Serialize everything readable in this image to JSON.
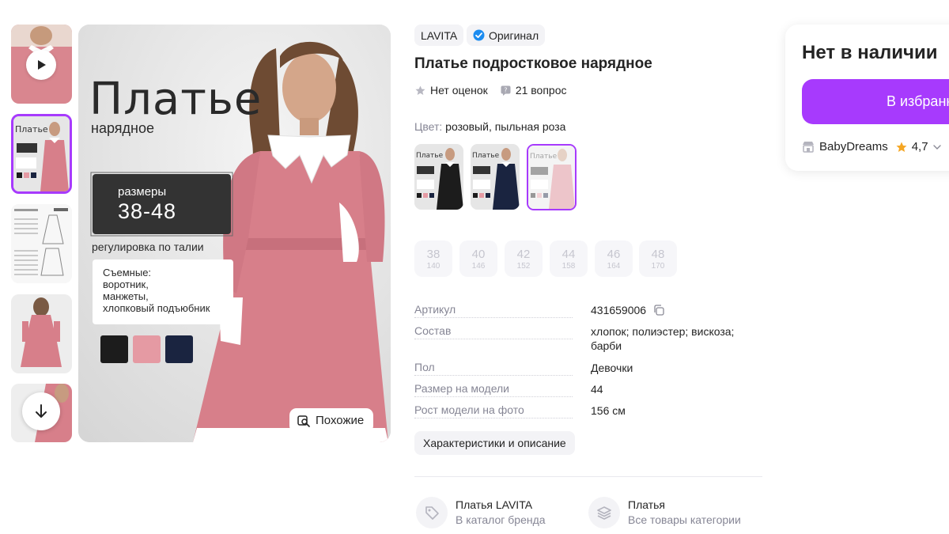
{
  "gallery": {
    "thumb_labels": [
      "video-preview",
      "cover",
      "size-chart",
      "back-view",
      "detail"
    ]
  },
  "photo": {
    "title": "Платье",
    "subtitle": "нарядное",
    "sizes_caption": "размеры",
    "sizes_value": "38-48",
    "waist_text": "регулировка по талии",
    "removable": [
      "Съемные:",
      "воротник,",
      "манжеты,",
      "хлопковый подъюбник"
    ],
    "similar_label": "Похожие",
    "swatch_colors": [
      "#1c1c1c",
      "#e59aa3",
      "#1a2440"
    ]
  },
  "badges": {
    "brand": "LAVITA",
    "original": "Оригинал"
  },
  "product": {
    "title": "Платье подростковое нарядное",
    "rating_text": "Нет оценок",
    "questions_text": "21 вопрос",
    "color_label": "Цвет:",
    "color_value": "розовый, пыльная роза"
  },
  "sizes": [
    {
      "size": "38",
      "height": "140"
    },
    {
      "size": "40",
      "height": "146"
    },
    {
      "size": "42",
      "height": "152"
    },
    {
      "size": "44",
      "height": "158"
    },
    {
      "size": "46",
      "height": "164"
    },
    {
      "size": "48",
      "height": "170"
    }
  ],
  "specs": [
    {
      "key": "Артикул",
      "value": "431659006"
    },
    {
      "key": "Состав",
      "value": "хлопок; полиэстер; вискоза; барби"
    },
    {
      "key": "Пол",
      "value": "Девочки"
    },
    {
      "key": "Размер на модели",
      "value": "44"
    },
    {
      "key": "Рост модели на фото",
      "value": "156 см"
    }
  ],
  "details_button": "Характеристики и описание",
  "links": [
    {
      "title": "Платья LAVITA",
      "subtitle": "В каталог бренда",
      "icon": "tag-icon"
    },
    {
      "title": "Платья",
      "subtitle": "Все товары категории",
      "icon": "layers-icon"
    }
  ],
  "side_card": {
    "status": "Нет в наличии",
    "favorite_button": "В избранное",
    "seller_name": "BabyDreams",
    "seller_rating": "4,7"
  },
  "colors": {
    "accent": "#a73afd",
    "dress_pink": "#d77f8a",
    "star": "#f5a623",
    "verified": "#1c8cf0"
  }
}
